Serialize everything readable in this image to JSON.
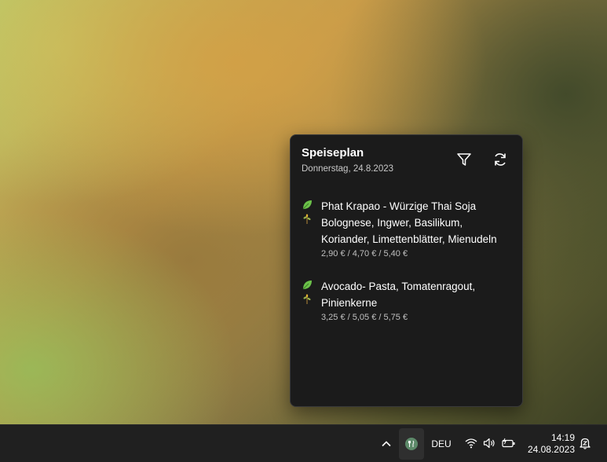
{
  "widget": {
    "title": "Speiseplan",
    "date": "Donnerstag, 24.8.2023",
    "filter_icon": "filter-icon",
    "refresh_icon": "refresh-icon",
    "meals": [
      {
        "name": "Phat Krapao - Würzige Thai Soja Bolognese, Ingwer, Basilikum, Koriander, Limettenblätter, Mienudeln",
        "price": "2,90 € / 4,70 € / 5,40 €",
        "icons": [
          "vegan-leaf-icon",
          "plant-icon"
        ]
      },
      {
        "name": "Avocado- Pasta, Tomatenragout, Pinienkerne",
        "price": "3,25 € / 5,05 € / 5,75 €",
        "icons": [
          "vegan-leaf-icon",
          "plant-icon"
        ]
      }
    ]
  },
  "taskbar": {
    "chevron_icon": "chevron-up-icon",
    "tray_app_icon": "cutlery-icon",
    "language": "DEU",
    "wifi_icon": "wifi-icon",
    "volume_icon": "speaker-icon",
    "battery_icon": "battery-icon",
    "time": "14:19",
    "date": "24.08.2023",
    "notification_icon": "notification-bell-icon"
  },
  "colors": {
    "widget_bg": "#1b1b1b",
    "taskbar_bg": "#202020",
    "leaf_green": "#6cc24a"
  }
}
